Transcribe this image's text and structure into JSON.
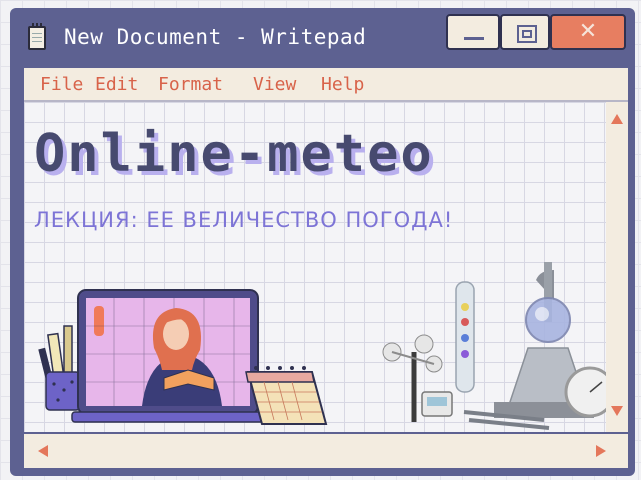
{
  "window": {
    "title": "New Document - Writepad",
    "minimize_icon": "minimize-icon",
    "maximize_icon": "maximize-icon",
    "close_symbol": "✕"
  },
  "menu": {
    "items": [
      {
        "label": "File"
      },
      {
        "label": "Edit"
      },
      {
        "label": "Format"
      },
      {
        "label": "View"
      },
      {
        "label": "Help"
      }
    ]
  },
  "document": {
    "heading": "Online-meteo",
    "subheading": "ЛЕКЦИЯ:  ЕЕ ВЕЛИЧЕСТВО ПОГОДА!"
  },
  "colors": {
    "window_frame": "#5d6191",
    "menu_bg": "#f3ece0",
    "menu_text": "#d8634a",
    "close_button": "#e77e61",
    "heading": "#474a6f",
    "subheading": "#7d74d6",
    "scroll_arrow": "#e4775b"
  },
  "icons": [
    "document-icon",
    "minimize-icon",
    "maximize-icon",
    "close-icon",
    "scroll-up-icon",
    "scroll-down-icon",
    "scroll-left-icon",
    "scroll-right-icon"
  ]
}
